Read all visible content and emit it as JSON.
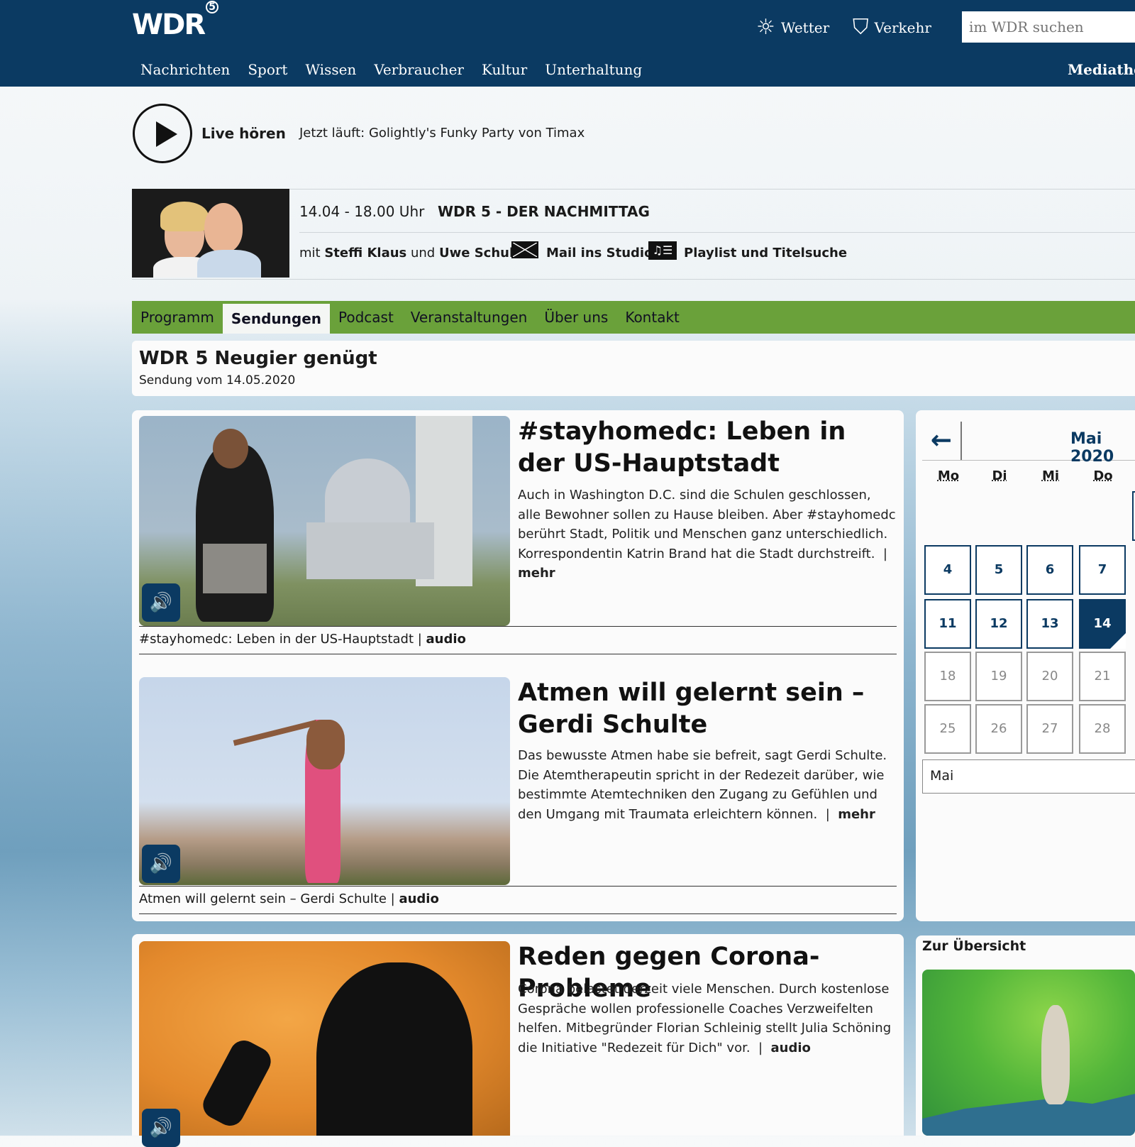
{
  "header": {
    "logo": "WDR",
    "logo_mark": "④",
    "weather_label": "Wetter",
    "traffic_label": "Verkehr",
    "search_placeholder": "im WDR suchen",
    "nav": [
      "Nachrichten",
      "Sport",
      "Wissen",
      "Verbraucher",
      "Kultur",
      "Unterhaltung"
    ],
    "mediathek": "Mediathek",
    "weather_icon": "sun-icon",
    "traffic_icon": "road-icon"
  },
  "live": {
    "label": "Live hören",
    "now_playing": "Jetzt läuft: Golightly's Funky Party von Timax",
    "play_icon": "play-icon"
  },
  "show": {
    "time": "14.04 - 18.00 Uhr",
    "title": "WDR 5 - DER NACHMITTAG",
    "hosts_prefix": "mit",
    "host1": "Steffi Klaus",
    "hosts_and": "und",
    "host2": "Uwe Schulz",
    "mail": "Mail ins Studio",
    "playlist": "Playlist und Titelsuche",
    "mail_icon": "envelope-icon",
    "playlist_icon": "playlist-icon"
  },
  "subnav": {
    "tabs": [
      "Programm",
      "Sendungen",
      "Podcast",
      "Veranstaltungen",
      "Über uns",
      "Kontakt"
    ],
    "active": "Sendungen"
  },
  "page": {
    "title": "WDR 5 Neugier genügt",
    "subtitle": "Sendung vom 14.05.2020"
  },
  "articles": [
    {
      "title": "#stayhomedc: Leben in der US-Hauptstadt",
      "text": "Auch in Washington D.C. sind die Schulen geschlossen, alle Bewohner sollen zu Hause bleiben. Aber #stayhomedc berührt Stadt, Politik und Menschen ganz unterschiedlich. Korrespondentin Katrin Brand hat die Stadt durchstreift.",
      "link": "mehr",
      "caption": "#stayhomedc: Leben in der US-Hauptstadt",
      "caption_type": "audio"
    },
    {
      "title": "Atmen will gelernt sein – Gerdi Schulte",
      "text": "Das bewusste Atmen habe sie befreit, sagt Gerdi Schulte. Die Atemtherapeutin spricht in der Redezeit darüber, wie bestimmte Atemtechniken den Zugang zu Gefühlen und den Umgang mit Traumata erleichtern können.",
      "link": "mehr",
      "caption": "Atmen will gelernt sein – Gerdi Schulte",
      "caption_type": "audio"
    },
    {
      "title": "Reden gegen Corona-Probleme",
      "text": "Corona belastet derzeit viele Menschen. Durch kostenlose Gespräche wollen professionelle Coaches Verzweifelten helfen. Mitbegründer Florian Schleinig stellt Julia Schöning die Initiative \"Redezeit für Dich\" vor.",
      "link": "audio"
    }
  ],
  "calendar": {
    "month": "Mai 2020",
    "back_icon": "arrow-left-icon",
    "weekdays": [
      "Mo",
      "Di",
      "Mi",
      "Do"
    ],
    "weeks": [
      [
        "4",
        "5",
        "6",
        "7"
      ],
      [
        "11",
        "12",
        "13",
        "14"
      ],
      [
        "18",
        "19",
        "20",
        "21"
      ],
      [
        "25",
        "26",
        "27",
        "28"
      ]
    ],
    "selected": "14",
    "month_select": "Mai"
  },
  "overview": {
    "title": "Zur Übersicht"
  },
  "colors": {
    "header_bg": "#0b3a62",
    "subnav_bg": "#6aa13a",
    "accent": "#0b3a62"
  }
}
